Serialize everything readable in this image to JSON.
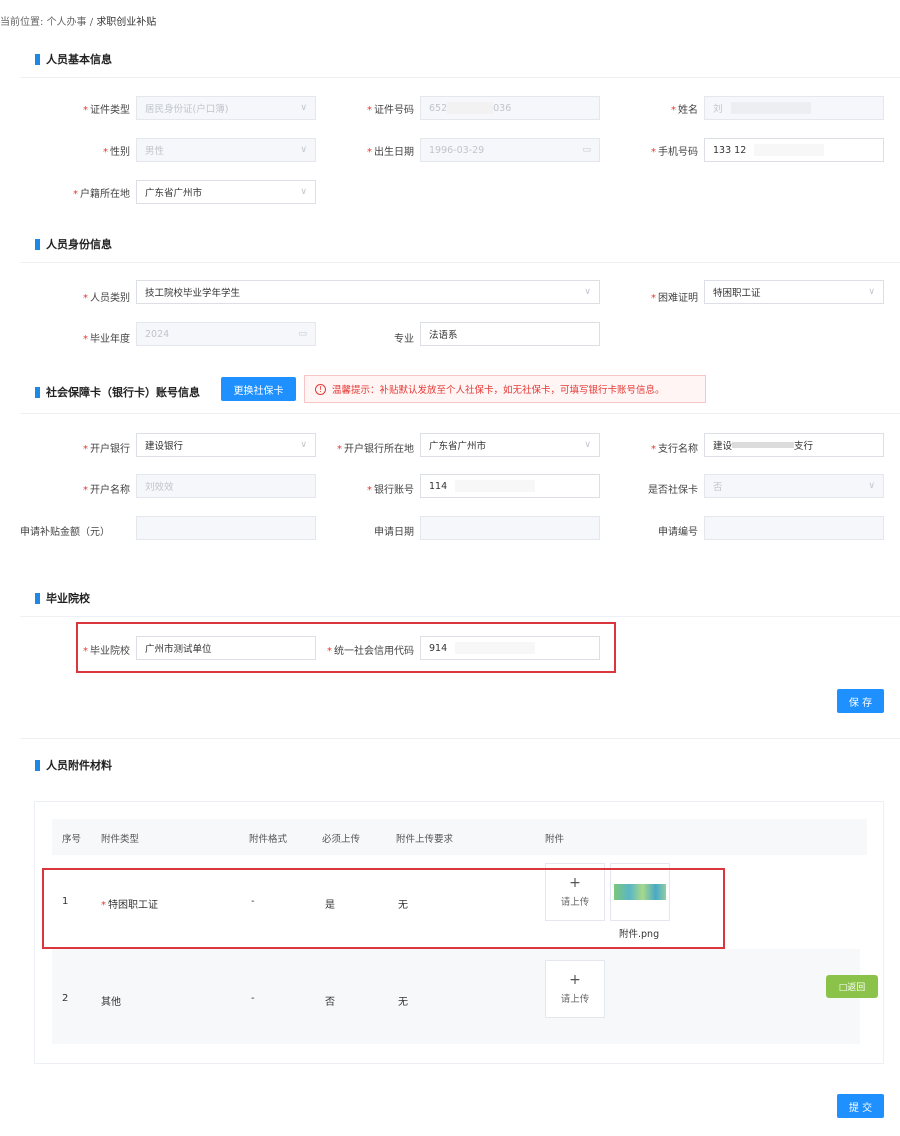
{
  "breadcrumb": {
    "prefix": "当前位置:",
    "level1": "个人办事",
    "sep": "/",
    "current": "求职创业补贴"
  },
  "section_basic": {
    "title": "人员基本信息",
    "id_type_label": "证件类型",
    "id_type_value": "居民身份证(户口簿)",
    "id_number_label": "证件号码",
    "id_number_prefix": "652",
    "id_number_suffix": "036",
    "name_label": "姓名",
    "name_value": "刘",
    "gender_label": "性别",
    "gender_value": "男性",
    "birth_label": "出生日期",
    "birth_value": "1996-03-29",
    "phone_label": "手机号码",
    "phone_value": "133 12",
    "household_label": "户籍所在地",
    "household_value": "广东省广州市"
  },
  "section_identity": {
    "title": "人员身份信息",
    "category_label": "人员类别",
    "category_value": "技工院校毕业学年学生",
    "hardship_label": "困难证明",
    "hardship_value": "特困职工证",
    "grad_year_label": "毕业年度",
    "grad_year_value": "2024",
    "major_label": "专业",
    "major_value": "法语系"
  },
  "section_bank": {
    "title": "社会保障卡（银行卡）账号信息",
    "change_button": "更换社保卡",
    "tip_text": "温馨提示：补贴默认发放至个人社保卡，如无社保卡，可填写银行卡账号信息。",
    "bank_label": "开户银行",
    "bank_value": "建设银行",
    "bank_location_label": "开户银行所在地",
    "bank_location_value": "广东省广州市",
    "branch_label": "支行名称",
    "branch_prefix": "建设",
    "branch_suffix": "支行",
    "account_name_label": "开户名称",
    "account_name_value": "刘效效",
    "account_no_label": "银行账号",
    "account_no_value": "114",
    "is_social_card_label": "是否社保卡",
    "is_social_card_value": "否",
    "amount_label": "申请补贴金额（元）",
    "apply_date_label": "申请日期",
    "apply_no_label": "申请编号"
  },
  "section_school": {
    "title": "毕业院校",
    "school_label": "毕业院校",
    "school_value": "广州市测试单位",
    "credit_code_label": "统一社会信用代码",
    "credit_code_value": "914",
    "save_button": "保 存"
  },
  "section_attach": {
    "title": "人员附件材料",
    "headers": [
      "序号",
      "附件类型",
      "附件格式",
      "必须上传",
      "附件上传要求",
      "附件"
    ],
    "rows": [
      {
        "no": "1",
        "type": "特困职工证",
        "format": "-",
        "required": "是",
        "requirement": "无",
        "upload_label": "请上传",
        "file_name": "附件.png"
      },
      {
        "no": "2",
        "type": "其他",
        "format": "-",
        "required": "否",
        "requirement": "无",
        "upload_label": "请上传"
      }
    ],
    "float_button": "□返回"
  },
  "submit_button": "提 交",
  "icons": {
    "select": "chevron-down-icon",
    "date": "calendar-icon",
    "plus": "plus-icon",
    "warning": "warning-circle-icon"
  },
  "colors": {
    "accent": "#1e90ff",
    "required": "#e53935",
    "highlight_box": "#d9363e",
    "float_button": "#8bc34a"
  }
}
